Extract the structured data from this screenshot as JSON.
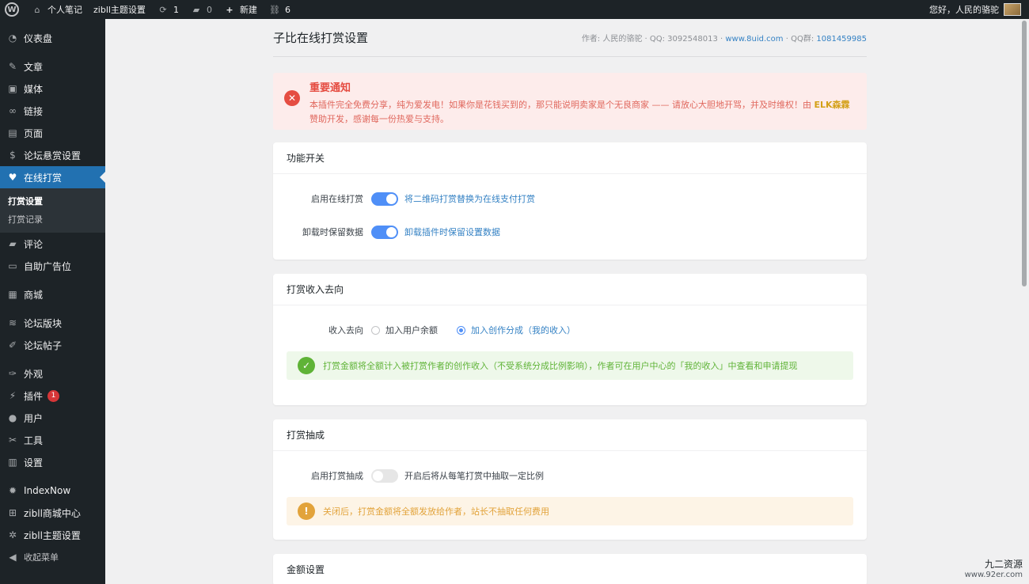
{
  "adminbar": {
    "site_name": "个人笔记",
    "theme_settings": "zibll主题设置",
    "updates_count": "1",
    "comments_count": "0",
    "new_label": "新建",
    "links_count": "6",
    "greeting": "您好，人民的骆驼"
  },
  "sidebar": {
    "items": [
      {
        "label": "仪表盘",
        "icon": "dashboard-icon"
      },
      {
        "label": "文章",
        "icon": "pin-icon"
      },
      {
        "label": "媒体",
        "icon": "media-icon"
      },
      {
        "label": "链接",
        "icon": "link-icon"
      },
      {
        "label": "页面",
        "icon": "page-icon"
      },
      {
        "label": "论坛悬赏设置",
        "icon": "dollar-icon"
      },
      {
        "label": "在线打赏",
        "icon": "heart-icon"
      },
      {
        "label": "评论",
        "icon": "comment-icon"
      },
      {
        "label": "自助广告位",
        "icon": "ad-icon"
      },
      {
        "label": "商城",
        "icon": "store-icon"
      },
      {
        "label": "论坛版块",
        "icon": "forum-icon"
      },
      {
        "label": "论坛帖子",
        "icon": "post-icon"
      },
      {
        "label": "外观",
        "icon": "brush-icon"
      },
      {
        "label": "插件",
        "icon": "plugin-icon",
        "badge": "1"
      },
      {
        "label": "用户",
        "icon": "user-icon"
      },
      {
        "label": "工具",
        "icon": "wrench-icon"
      },
      {
        "label": "设置",
        "icon": "settings-icon"
      },
      {
        "label": "IndexNow",
        "icon": "gear-icon"
      },
      {
        "label": "zibll商城中心",
        "icon": "cart-icon"
      },
      {
        "label": "zibll主题设置",
        "icon": "cog-icon"
      },
      {
        "label": "收起菜单",
        "icon": "collapse-icon"
      }
    ],
    "submenu": [
      "打赏设置",
      "打赏记录"
    ]
  },
  "page": {
    "title": "子比在线打赏设置",
    "author_prefix": "作者: 人民的骆驼 · QQ: 3092548013 ·",
    "site_link": "www.8uid.com",
    "qq_group_prefix": "· QQ群:",
    "qq_group": "1081459985"
  },
  "notice": {
    "title": "重要通知",
    "text_1": "本插件完全免费分享，纯为爱发电！如果你是花钱买到的，那只能说明卖家是个无良商家 —— 请放心大胆地开骂，并及时维权！由",
    "brand": "ELK森霖",
    "text_2": "赞助开发，感谢每一份热爱与支持。"
  },
  "sections": {
    "toggles": {
      "title": "功能开关",
      "enable_label": "启用在线打赏",
      "enable_desc": "将二维码打赏替换为在线支付打赏",
      "keep_label": "卸载时保留数据",
      "keep_desc": "卸载插件时保留设置数据"
    },
    "income": {
      "title": "打赏收入去向",
      "label": "收入去向",
      "option_1": "加入用户余额",
      "option_2": "加入创作分成（我的收入）",
      "alert": "打赏金额将全额计入被打赏作者的创作收入（不受系统分成比例影响），作者可在用户中心的「我的收入」中查看和申请提现"
    },
    "commission": {
      "title": "打赏抽成",
      "label": "启用打赏抽成",
      "desc": "开启后将从每笔打赏中抽取一定比例",
      "alert": "关闭后，打赏金额将全额发放给作者，站长不抽取任何费用"
    },
    "amount": {
      "title": "金额设置"
    }
  },
  "watermark": {
    "name": "九二资源",
    "url": "www.92er.com"
  },
  "colors": {
    "accent": "#2271b1",
    "toggle_on": "#4f8ff7",
    "error": "#e54d42",
    "success": "#5fb337",
    "warning": "#e2a33b"
  }
}
